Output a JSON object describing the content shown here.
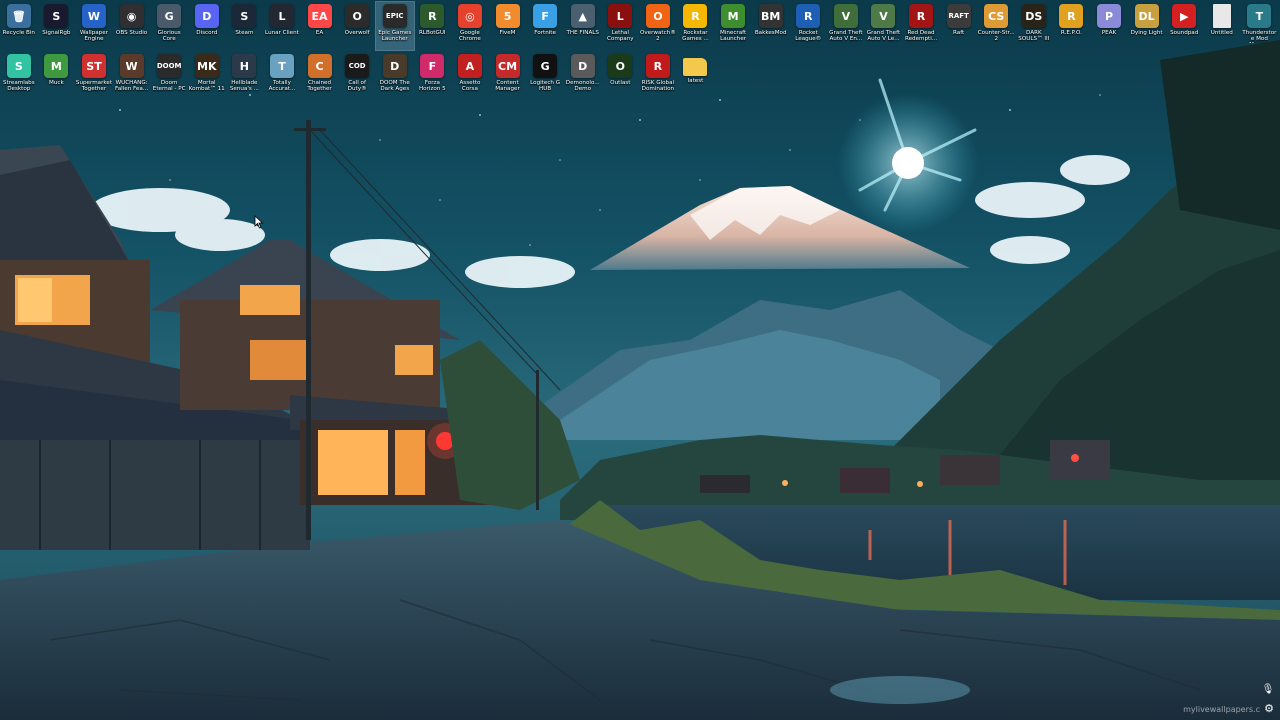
{
  "desktop": {
    "icons_row1": [
      {
        "label": "Recycle Bin",
        "icon": "recycle-bin-icon",
        "glyph": "🗑",
        "color": "#3a6f9e"
      },
      {
        "label": "SignalRgb",
        "icon": "signalrgb-icon",
        "glyph": "S",
        "color": "#1a1a2e"
      },
      {
        "label": "Wallpaper Engine",
        "icon": "wallpaper-engine-icon",
        "glyph": "W",
        "color": "#2563c9"
      },
      {
        "label": "OBS Studio",
        "icon": "obs-icon",
        "glyph": "◉",
        "color": "#302e31"
      },
      {
        "label": "Glorious Core",
        "icon": "glorious-icon",
        "glyph": "G",
        "color": "#4a5a6a"
      },
      {
        "label": "Discord",
        "icon": "discord-icon",
        "glyph": "D",
        "color": "#5865f2"
      },
      {
        "label": "Steam",
        "icon": "steam-icon",
        "glyph": "S",
        "color": "#1b2838"
      },
      {
        "label": "Lunar Client",
        "icon": "lunar-client-icon",
        "glyph": "L",
        "color": "#222831"
      },
      {
        "label": "EA",
        "icon": "ea-icon",
        "glyph": "EA",
        "color": "#ff4747"
      },
      {
        "label": "Overwolf",
        "icon": "overwolf-icon",
        "glyph": "O",
        "color": "#2b2b2b"
      },
      {
        "label": "Epic Games Launcher",
        "icon": "epic-games-icon",
        "glyph": "EPIC",
        "color": "#2a2a2a"
      },
      {
        "label": "RLBotGUI",
        "icon": "rlbot-icon",
        "glyph": "R",
        "color": "#2d5a2d"
      },
      {
        "label": "Google Chrome",
        "icon": "chrome-icon",
        "glyph": "◎",
        "color": "#e5412d"
      },
      {
        "label": "FiveM",
        "icon": "fivem-icon",
        "glyph": "5",
        "color": "#f28a2e"
      },
      {
        "label": "Fortnite",
        "icon": "fortnite-icon",
        "glyph": "F",
        "color": "#3aa0e6"
      },
      {
        "label": "THE FINALS",
        "icon": "the-finals-icon",
        "glyph": "▲",
        "color": "#4a6070"
      },
      {
        "label": "Lethal Company",
        "icon": "lethal-company-icon",
        "glyph": "L",
        "color": "#8a1010"
      },
      {
        "label": "Overwatch® 2",
        "icon": "overwatch-icon",
        "glyph": "O",
        "color": "#f06414"
      },
      {
        "label": "Rockstar Games ...",
        "icon": "rockstar-icon",
        "glyph": "R",
        "color": "#f5b700"
      },
      {
        "label": "Minecraft Launcher",
        "icon": "minecraft-icon",
        "glyph": "M",
        "color": "#3e8e2f"
      },
      {
        "label": "BakkesMod",
        "icon": "bakkesmod-icon",
        "glyph": "BM",
        "color": "#333333"
      },
      {
        "label": "Rocket League®",
        "icon": "rocket-league-icon",
        "glyph": "R",
        "color": "#1e5fb3"
      },
      {
        "label": "Grand Theft Auto V En...",
        "icon": "gta5-enhanced-icon",
        "glyph": "V",
        "color": "#3f6e3a"
      },
      {
        "label": "Grand Theft Auto V Le...",
        "icon": "gta5-legacy-icon",
        "glyph": "V",
        "color": "#4d7a46"
      },
      {
        "label": "Red Dead Redempti...",
        "icon": "red-dead-icon",
        "glyph": "R",
        "color": "#a31515"
      },
      {
        "label": "Raft",
        "icon": "raft-icon",
        "glyph": "RAFT",
        "color": "#3b3b3b"
      },
      {
        "label": "Counter-Str... 2",
        "icon": "counter-strike-icon",
        "glyph": "CS",
        "color": "#de9b35"
      },
      {
        "label": "DARK SOULS™ III",
        "icon": "dark-souls-icon",
        "glyph": "DS",
        "color": "#2a2418"
      },
      {
        "label": "R.E.P.O.",
        "icon": "repo-icon",
        "glyph": "R",
        "color": "#e0a020"
      },
      {
        "label": "PEAK",
        "icon": "peak-icon",
        "glyph": "P",
        "color": "#8a8ad8"
      },
      {
        "label": "Dying Light",
        "icon": "dying-light-icon",
        "glyph": "DL",
        "color": "#c8a040"
      },
      {
        "label": "Soundpad",
        "icon": "soundpad-icon",
        "glyph": "▶",
        "color": "#d42020"
      },
      {
        "label": "Untitled",
        "icon": "blank-document-icon",
        "glyph": "",
        "color": "#e8e8e8"
      },
      {
        "label": "Thunderstore Mod Mana...",
        "icon": "thunderstore-icon",
        "glyph": "T",
        "color": "#2a7a8a"
      }
    ],
    "icons_row2": [
      {
        "label": "Streamlabs Desktop",
        "icon": "streamlabs-icon",
        "glyph": "S",
        "color": "#31c3a2"
      },
      {
        "label": "Muck",
        "icon": "muck-icon",
        "glyph": "M",
        "color": "#3f9a3f"
      },
      {
        "label": "Supermarket Together",
        "icon": "supermarket-together-icon",
        "glyph": "ST",
        "color": "#d03030"
      },
      {
        "label": "WUCHANG: Fallen Fea...",
        "icon": "wuchang-icon",
        "glyph": "W",
        "color": "#5a3a2a"
      },
      {
        "label": "Doom Eternal - PC",
        "icon": "doom-eternal-icon",
        "glyph": "DOOM",
        "color": "#2a2a2a"
      },
      {
        "label": "Mortal Kombat™ 11",
        "icon": "mortal-kombat-icon",
        "glyph": "MK",
        "color": "#3a2a1a"
      },
      {
        "label": "Hellblade Senua's ...",
        "icon": "hellblade-icon",
        "glyph": "H",
        "color": "#2a3a4a"
      },
      {
        "label": "Totally Accurat...",
        "icon": "tabs-icon",
        "glyph": "T",
        "color": "#6aa0c0"
      },
      {
        "label": "Chained Together",
        "icon": "chained-together-icon",
        "glyph": "C",
        "color": "#d0702a"
      },
      {
        "label": "Call of Duty®",
        "icon": "call-of-duty-icon",
        "glyph": "COD",
        "color": "#1a1a1a"
      },
      {
        "label": "DOOM The Dark Ages",
        "icon": "doom-dark-ages-icon",
        "glyph": "D",
        "color": "#4a3a2a"
      },
      {
        "label": "Forza Horizon 5",
        "icon": "forza-icon",
        "glyph": "F",
        "color": "#d02a6a"
      },
      {
        "label": "Assetto Corsa",
        "icon": "assetto-corsa-icon",
        "glyph": "A",
        "color": "#c02020"
      },
      {
        "label": "Content Manager",
        "icon": "content-manager-icon",
        "glyph": "CM",
        "color": "#c42a2a"
      },
      {
        "label": "Logitech G HUB",
        "icon": "logitech-ghub-icon",
        "glyph": "G",
        "color": "#111111"
      },
      {
        "label": "Demonolo... Demo",
        "icon": "demonologist-icon",
        "glyph": "D",
        "color": "#5a5a5a"
      },
      {
        "label": "Outlast",
        "icon": "outlast-icon",
        "glyph": "O",
        "color": "#1a3a1a"
      },
      {
        "label": "RISK Global Domination",
        "icon": "risk-icon",
        "glyph": "R",
        "color": "#c01a1a"
      },
      {
        "label": "latest",
        "icon": "folder-icon",
        "glyph": "",
        "color": "#f2c94c"
      }
    ],
    "selected_icon": "Epic Games Launcher"
  },
  "overlay": {
    "watermark": "mylivewallpapers.c",
    "mic_glyph": "🎙",
    "gear_glyph": "⚙"
  }
}
